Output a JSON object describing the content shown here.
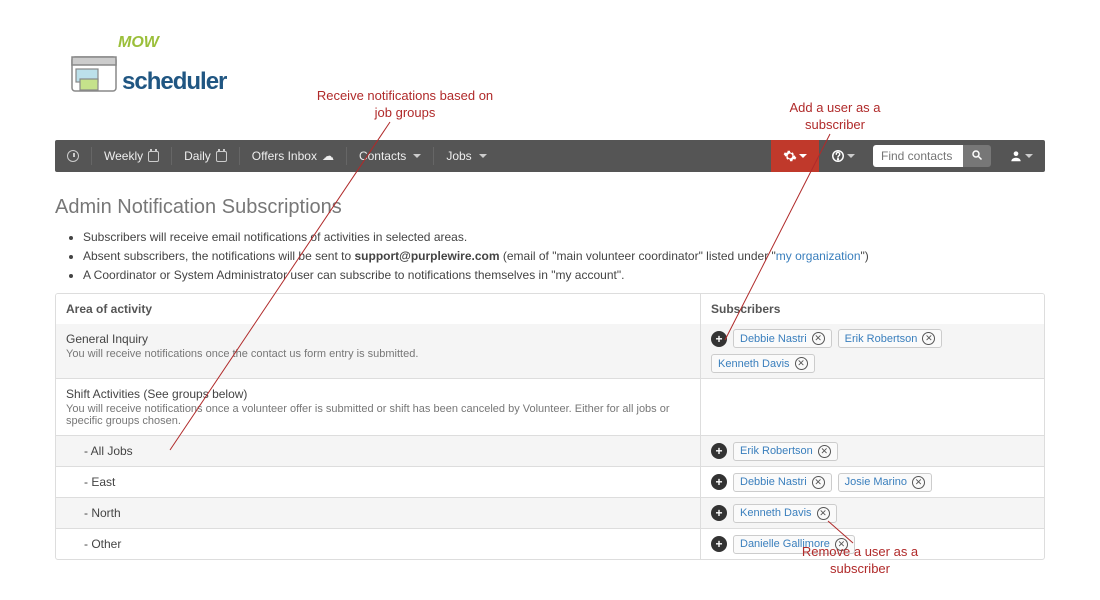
{
  "logo": {
    "brand": "scheduler",
    "mow": "MOW"
  },
  "nav": {
    "weekly": "Weekly",
    "daily": "Daily",
    "offers": "Offers Inbox",
    "contacts": "Contacts",
    "jobs": "Jobs",
    "search_placeholder": "Find contacts"
  },
  "page_title": "Admin Notification Subscriptions",
  "info": {
    "li1": "Subscribers will receive email notifications of activities in selected areas.",
    "li2a": "Absent subscribers, the notifications will be sent to ",
    "li2b": "support@purplewire.com",
    "li2c": " (email of \"main volunteer coordinator\" listed under \"",
    "li2d": "my organization",
    "li2e": "\")",
    "li3": "A Coordinator or System Administrator user can subscribe to notifications themselves in \"my account\"."
  },
  "columns": {
    "area": "Area of activity",
    "subs": "Subscribers"
  },
  "rows": [
    {
      "title": "General Inquiry",
      "desc": "You will receive notifications once the contact us form entry is submitted.",
      "has_add": true,
      "stripe": true,
      "chips": [
        "Debbie Nastri",
        "Erik Robertson",
        "Kenneth Davis"
      ]
    },
    {
      "title": "Shift Activities (See groups below)",
      "desc": "You will receive notifications once a volunteer offer is submitted or shift has been canceled by Volunteer. Either for all jobs or specific groups chosen.",
      "has_add": false,
      "stripe": false,
      "chips": []
    },
    {
      "title": "- All Jobs",
      "indent": true,
      "has_add": true,
      "stripe": true,
      "chips": [
        "Erik Robertson"
      ]
    },
    {
      "title": "- East",
      "indent": true,
      "has_add": true,
      "stripe": false,
      "chips": [
        "Debbie Nastri",
        "Josie Marino"
      ]
    },
    {
      "title": "- North",
      "indent": true,
      "has_add": true,
      "stripe": true,
      "chips": [
        "Kenneth Davis"
      ]
    },
    {
      "title": "- Other",
      "indent": true,
      "has_add": true,
      "stripe": false,
      "chips": [
        "Danielle Gallimore"
      ]
    }
  ],
  "annotations": {
    "a1": "Receive notifications based on\njob groups",
    "a2": "Add a user as a\nsubscriber",
    "a3": "Remove a user as a\nsubscriber"
  }
}
